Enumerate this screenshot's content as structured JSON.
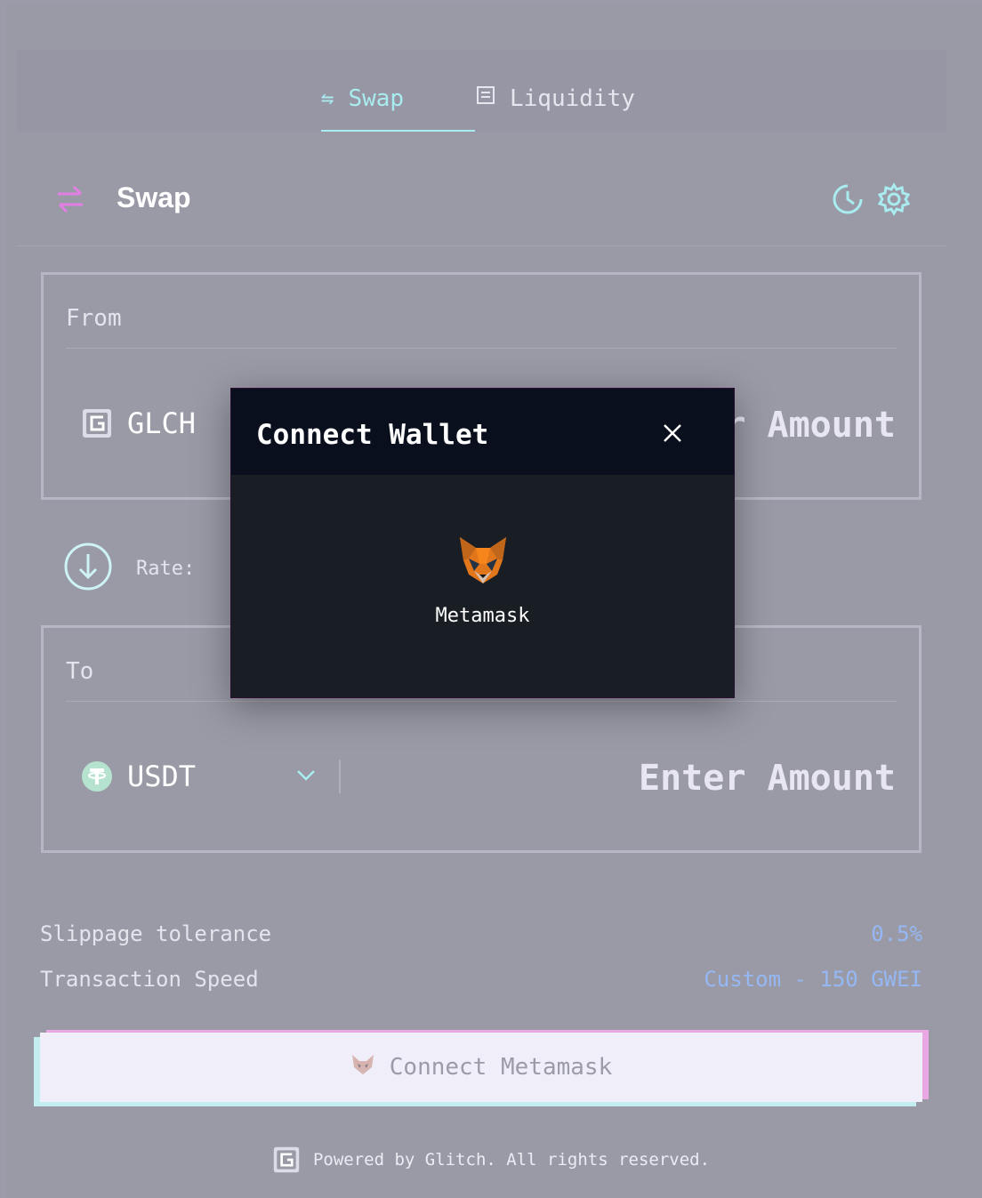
{
  "tabs": [
    {
      "label": "Swap",
      "active": true,
      "icon": "swap-arrows-icon"
    },
    {
      "label": "Liquidity",
      "active": false,
      "icon": "pool-icon"
    }
  ],
  "header": {
    "title": "Swap",
    "icons": [
      "swap-arrows-icon",
      "history-icon",
      "gear-icon"
    ]
  },
  "from": {
    "label": "From",
    "token": "GLCH",
    "amount_placeholder": "Enter Amount",
    "amount_visible": "r Amount"
  },
  "rate": {
    "label": "Rate:"
  },
  "to": {
    "label": "To",
    "token": "USDT",
    "amount_placeholder": "Enter Amount"
  },
  "settings": {
    "slippage_label": "Slippage tolerance",
    "slippage_value": "0.5%",
    "speed_label": "Transaction Speed",
    "speed_value": "Custom - 150 GWEI"
  },
  "cta": {
    "label": "Connect Metamask"
  },
  "footer": {
    "text": "Powered by Glitch. All rights reserved."
  },
  "modal": {
    "title": "Connect Wallet",
    "option_label": "Metamask"
  },
  "colors": {
    "accent": "#a9ecef",
    "link": "#95b8f4",
    "modal_bg": "#181e23",
    "modal_head": "#0a0f1d"
  }
}
